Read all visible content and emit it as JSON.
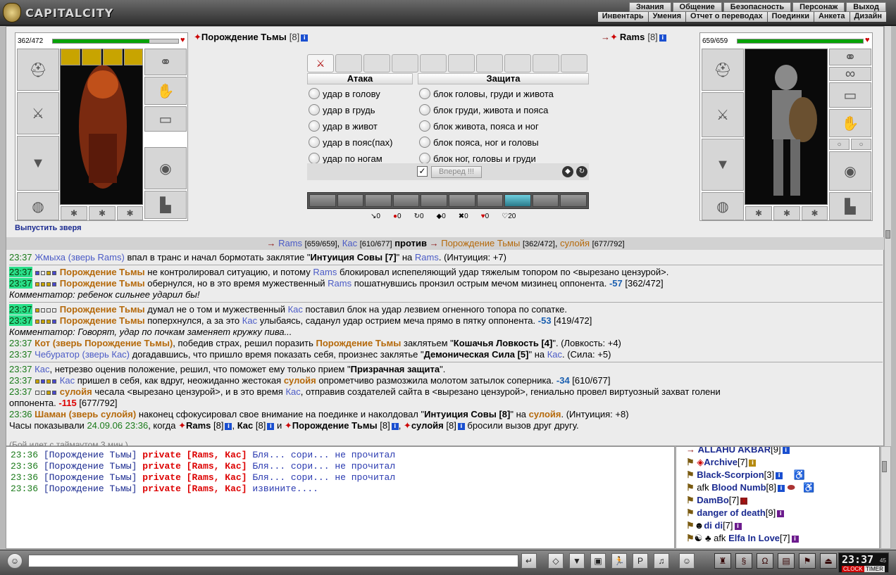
{
  "app": {
    "name": "CAPITALCITY"
  },
  "menu_top": [
    "Знания",
    "Общение",
    "Безопасность",
    "Персонаж",
    "Выход"
  ],
  "menu_sub": [
    "Инвентарь",
    "Умения",
    "Отчет о переводах",
    "Поединки",
    "Анкета",
    "Дизайн"
  ],
  "left_fighter": {
    "hp": "362/472",
    "hp_fraction": 0.767,
    "name": "Порождение Тьмы",
    "level": "[8]",
    "release_beast": "Выпустить зверя"
  },
  "right_fighter": {
    "hp": "659/659",
    "hp_fraction": 1.0,
    "name": "Rams",
    "level": "[8]"
  },
  "attack": {
    "header": "Атака",
    "options": [
      "удар в голову",
      "удар в грудь",
      "удар в живот",
      "удар в пояс(пах)",
      "удар по ногам"
    ]
  },
  "defense": {
    "header": "Защита",
    "options": [
      "блок головы, груди и живота",
      "блок груди, живота и пояса",
      "блок живота, пояса и ног",
      "блок пояса, ног и головы",
      "блок ног, головы и груди"
    ]
  },
  "forward_button": "Вперед !!!",
  "forward_checked": "✓",
  "counters": [
    "0",
    "0",
    "0",
    "0",
    "0",
    "0",
    "20"
  ],
  "battle_header": {
    "team1": [
      {
        "name": "Rams",
        "hp": "[659/659]"
      },
      {
        "name": "Кас",
        "hp": "[610/677]"
      }
    ],
    "vs": "против",
    "team2": [
      {
        "name": "Порождение Тьмы",
        "hp": "[362/472]"
      },
      {
        "name": "сулойя",
        "hp": "[677/792]"
      }
    ]
  },
  "log": {
    "l1": {
      "time": "23:37",
      "actor": "Жмыха (зверь Rams)",
      "text1": " впал в транс и начал бормотать заклятие \"",
      "spell": "Интуиция Совы [7]",
      "text2": "\" на ",
      "target": "Rams",
      "text3": ". (Интуиция: +7)"
    },
    "l2": {
      "time": "23:37",
      "actor": "Порождение Тьмы",
      "text1": " не контролировал ситуацию, и потому ",
      "target": "Rams",
      "text2": " блокировал испепеляющий удар тяжелым топором по <вырезано цензурой>."
    },
    "l3": {
      "time": "23:37",
      "actor": "Порождение Тьмы",
      "text1": " обернулся, но в это время мужественный ",
      "target": "Rams",
      "text2": " пошатнувшись пронзил острым мечом мизинец оппонента. ",
      "dmg": "-57",
      "hp": " [362/472]"
    },
    "l4": {
      "text": "Комментатор: ребенок сильнее ударил бы!"
    },
    "l5": {
      "time": "23:37",
      "actor": "Порождение Тьмы",
      "text1": " думал не о том и мужественный ",
      "target": "Кас",
      "text2": " поставил блок на удар лезвием огненного топора по сопатке."
    },
    "l6": {
      "time": "23:37",
      "actor": "Порождение Тьмы",
      "text1": " поперхнулся, а за это ",
      "target": "Кас",
      "text2": " улыбаясь, саданул удар острием меча прямо в пятку оппонента. ",
      "dmg": "-53",
      "hp": " [419/472]"
    },
    "l7": {
      "text": "Комментатор: Говорят, удар по почкам заменяет кружку пива..."
    },
    "l8": {
      "time": "23:37",
      "actor": "Кот (зверь Порождение Тьмы)",
      "text1": ", победив страх, решил поразить ",
      "target": "Порождение Тьмы",
      "text2": " заклятьем \"",
      "spell": "Кошачья Ловкость [4]",
      "text3": "\". (Ловкость: +4)"
    },
    "l9": {
      "time": "23:37",
      "actor": "Чебуратор (зверь Кас)",
      "text1": " догадавшись, что пришло время показать себя, произнес заклятье \"",
      "spell": "Демоническая Сила [5]",
      "text2": "\" на ",
      "target": "Кас",
      "text3": ". (Сила: +5)"
    },
    "l10": {
      "time": "23:37",
      "actor": "Кас",
      "text1": ", нетрезво оценив положение, решил, что поможет ему только прием \"",
      "spell": "Призрачная защита",
      "text2": "\"."
    },
    "l11": {
      "time": "23:37",
      "actor": "Кас",
      "text1": " пришел в себя, как вдруг, неожиданно жестокая ",
      "target": "сулойя",
      "text2": " опрометчиво размозжила молотом затылок соперника. ",
      "dmg": "-34",
      "hp": " [610/677]"
    },
    "l12": {
      "time": "23:37",
      "actor": "сулойя",
      "text1": " чесала <вырезано цензурой>, и в это время ",
      "target": "Кас",
      "text2": ", отправив создателей сайта в <вырезано цензурой>, гениально провел виртуозный захват голени"
    },
    "l12b": {
      "text": "оппонента. ",
      "dmg": "-115",
      "hp": " [677/792]"
    },
    "l13": {
      "time": "23:36",
      "actor": "Шаман (зверь сулойя)",
      "text1": " наконец сфокусировал свое внимание на поединке и наколдовал \"",
      "spell": "Интуиция Совы [8]",
      "text2": "\" на ",
      "target": "сулойя",
      "text3": ". (Интуиция: +8)"
    },
    "l14": {
      "text1": "Часы показывали ",
      "date": "24.09.06 23:36",
      "text2": ", когда ",
      "p1": "Rams",
      "p1l": " [8]",
      "p2": "Кас",
      "p2l": " [8]",
      "and": " и ",
      "p3": "Порождение Тьмы",
      "p3l": " [8]",
      "p4": "сулойя",
      "p4l": " [8]",
      "text3": " бросили вызов друг другу."
    }
  },
  "waiting": "(Бой идет с таймаутом 3 мин.)",
  "chat": [
    {
      "time": "23:36",
      "name": "[Порождение Тьмы]",
      "priv": "private [Rams, Кас]",
      "msg": "Бля... сори... не прочитал"
    },
    {
      "time": "23:36",
      "name": "[Порождение Тьмы]",
      "priv": "private [Rams, Кас]",
      "msg": "Бля... сори... не прочитал"
    },
    {
      "time": "23:36",
      "name": "[Порождение Тьмы]",
      "priv": "private [Rams, Кас]",
      "msg": "Бля... сори... не прочитал"
    },
    {
      "time": "23:36",
      "name": "[Порождение Тьмы]",
      "priv": "private [Rams, Кас]",
      "msg": "извините...."
    }
  ],
  "users": [
    {
      "name": "ALLAHU AKBAR",
      "level": "[9]"
    },
    {
      "name": "Archive",
      "level": "[7]"
    },
    {
      "name": "Black-Scorpion",
      "level": "[3]"
    },
    {
      "prefix": "afk",
      "name": "Blood Numb",
      "level": "[8]"
    },
    {
      "name": "DamBo",
      "level": "[7]"
    },
    {
      "name": "danger of death",
      "level": "[9]"
    },
    {
      "name": "di di",
      "level": "[7]"
    },
    {
      "prefix": "afk",
      "name": "Elfa In Love",
      "level": "[7]"
    }
  ],
  "clock": {
    "time": "23:37",
    "sec": "45",
    "clock_label": "CLOCK",
    "timer_label": "TIMER"
  },
  "colors": {
    "hp_green": "#07a307",
    "player_blue": "#4b5bc6",
    "enemy_orange": "#b5690a",
    "damage_red": "#d00"
  }
}
